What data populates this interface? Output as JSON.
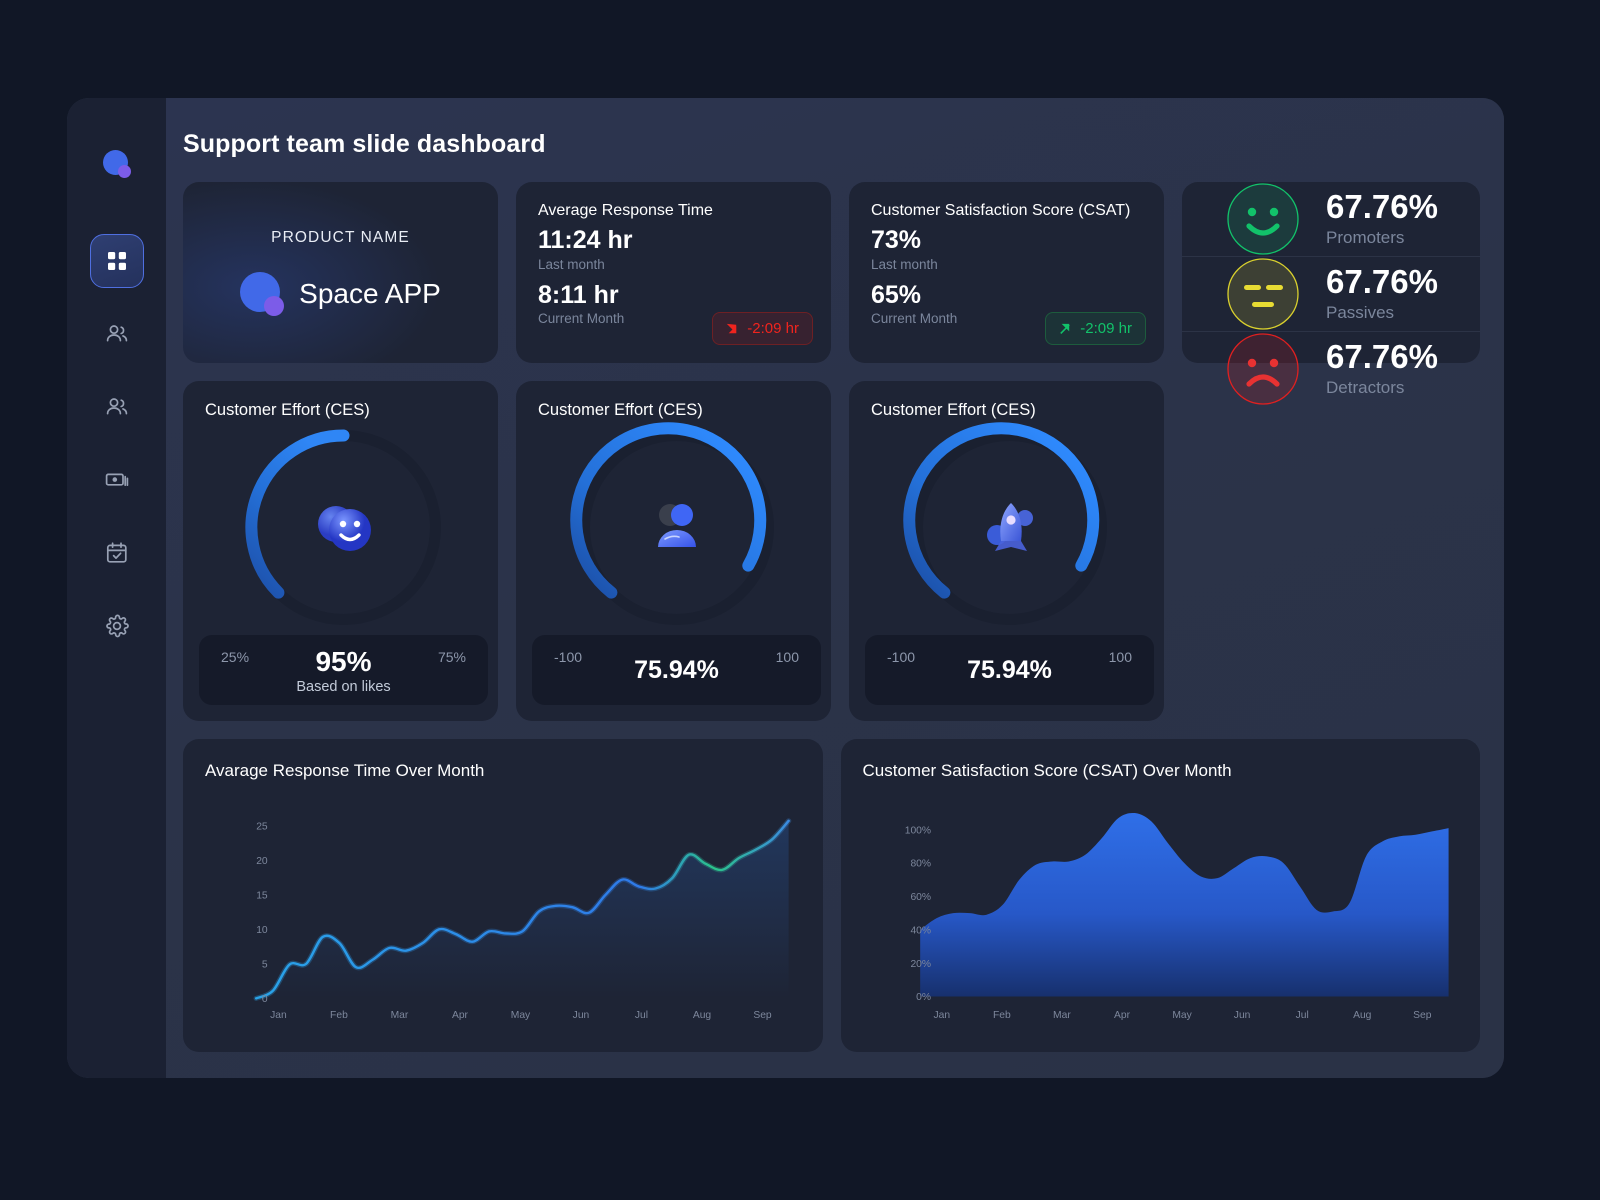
{
  "page_title": "Support team slide dashboard",
  "colors": {
    "accent_blue": "#2b7cf0",
    "logo_blue": "#4169e8",
    "logo_purple": "#7c5ce8",
    "positive_green": "#12c26a",
    "negative_red": "#f0241e",
    "passive_yellow": "#d9d02e",
    "card_bg": "#1e2435",
    "panel_bg": "#2b3349",
    "sidebar_bg": "#1b2133",
    "page_bg": "#111726"
  },
  "sidebar": {
    "logo_name": "app-logo",
    "items": [
      {
        "name": "dashboard",
        "icon": "grid-icon",
        "active": true
      },
      {
        "name": "customers",
        "icon": "users-icon",
        "active": false
      },
      {
        "name": "team",
        "icon": "users-icon",
        "active": false
      },
      {
        "name": "billing",
        "icon": "cash-icon",
        "active": false
      },
      {
        "name": "calendar",
        "icon": "calendar-check-icon",
        "active": false
      },
      {
        "name": "settings",
        "icon": "gear-icon",
        "active": false
      }
    ]
  },
  "product_card": {
    "label": "PRODUCT NAME",
    "name": "Space APP"
  },
  "response_time_card": {
    "title": "Average Response Time",
    "last_value": "11:24 hr",
    "last_label": "Last month",
    "current_value": "8:11 hr",
    "current_label": "Current Month",
    "badge": "-2:09 hr",
    "badge_direction": "down",
    "badge_icon": "arrow-down-right-icon"
  },
  "csat_card": {
    "title": "Customer Satisfaction Score (CSAT)",
    "last_value": "73%",
    "last_label": "Last month",
    "current_value": "65%",
    "current_label": "Current Month",
    "badge": "-2:09 hr",
    "badge_direction": "up",
    "badge_icon": "arrow-up-right-icon"
  },
  "nps_panel": {
    "rows": [
      {
        "value": "67.76%",
        "label": "Promoters",
        "icon": "smiley-happy-icon",
        "color": "#12c26a"
      },
      {
        "value": "67.76%",
        "label": "Passives",
        "icon": "smiley-neutral-icon",
        "color": "#d9d02e"
      },
      {
        "value": "67.76%",
        "label": "Detractors",
        "icon": "smiley-sad-icon",
        "color": "#e02020"
      }
    ]
  },
  "ces_cards": [
    {
      "title": "Customer Effort (CES)",
      "icon": "smiley-face-3d-icon",
      "left_scale": "25%",
      "right_scale": "75%",
      "value": "95%",
      "sub": "Based on likes",
      "gauge_percent": 50
    },
    {
      "title": "Customer Effort (CES)",
      "icon": "user-avatar-3d-icon",
      "left_scale": "-100",
      "right_scale": "100",
      "value": "75.94%",
      "sub": "",
      "gauge_percent": 84
    },
    {
      "title": "Customer Effort (CES)",
      "icon": "rocket-3d-icon",
      "left_scale": "-100",
      "right_scale": "100",
      "value": "75.94%",
      "sub": "",
      "gauge_percent": 84
    }
  ],
  "chart_data": [
    {
      "type": "line",
      "title": "Avarage Response Time Over Month",
      "xlabel": "",
      "ylabel": "",
      "grid": false,
      "legend": "none",
      "categories": [
        "Jan",
        "Feb",
        "Mar",
        "Apr",
        "May",
        "Jun",
        "Jul",
        "Aug",
        "Sep"
      ],
      "yticks": [
        0,
        5,
        10,
        15,
        20,
        25
      ],
      "ylim": [
        0,
        27
      ],
      "series": [
        {
          "name": "Average Response Time (hr)",
          "color_start": "#29a3e8",
          "color_end": "#2bc48a",
          "x": [
            0.0,
            0.25,
            0.5,
            0.75,
            1.0,
            1.25,
            1.5,
            1.75,
            2.0,
            2.25,
            2.5,
            2.75,
            3.0,
            3.25,
            3.5,
            3.75,
            4.0,
            4.25,
            4.5,
            4.75,
            5.0,
            5.25,
            5.5,
            5.75,
            6.0,
            6.25,
            6.5,
            6.75,
            7.0,
            7.25,
            7.5,
            7.75,
            8.0
          ],
          "values": [
            0.0,
            1.1,
            4.9,
            5.0,
            8.9,
            8.0,
            4.5,
            5.6,
            7.3,
            6.9,
            8.0,
            10.0,
            9.3,
            8.2,
            9.7,
            9.4,
            9.7,
            12.6,
            13.4,
            13.2,
            12.4,
            15.0,
            17.2,
            16.2,
            15.9,
            17.4,
            20.8,
            19.5,
            18.6,
            20.3,
            21.5,
            23.0,
            25.7
          ]
        }
      ]
    },
    {
      "type": "area",
      "title": "Customer Satisfaction Score (CSAT) Over Month",
      "xlabel": "",
      "ylabel": "",
      "grid": false,
      "legend": "none",
      "categories": [
        "Jan",
        "Feb",
        "Mar",
        "Apr",
        "May",
        "Jun",
        "Jul",
        "Aug",
        "Sep"
      ],
      "yticks": [
        "0%",
        "20%",
        "40%",
        "60%",
        "80%",
        "100%"
      ],
      "ylim": [
        0,
        115
      ],
      "series": [
        {
          "name": "CSAT (%)",
          "color_top": "#2f6fe8",
          "color_bottom": "#17306d",
          "x": [
            0.0,
            0.25,
            0.5,
            0.75,
            1.0,
            1.25,
            1.5,
            1.75,
            2.0,
            2.25,
            2.5,
            2.75,
            3.0,
            3.25,
            3.5,
            3.75,
            4.0,
            4.25,
            4.5,
            4.75,
            5.0,
            5.25,
            5.5,
            5.75,
            6.0,
            6.25,
            6.5,
            6.75,
            7.0,
            7.25,
            7.5,
            7.75,
            8.0
          ],
          "values": [
            40,
            47,
            50,
            50,
            49,
            55,
            70,
            79,
            81,
            81,
            85,
            95,
            107,
            110,
            105,
            92,
            80,
            72,
            71,
            77,
            83,
            84,
            80,
            66,
            52,
            51,
            56,
            84,
            93,
            96,
            97,
            99,
            101
          ]
        }
      ]
    }
  ]
}
